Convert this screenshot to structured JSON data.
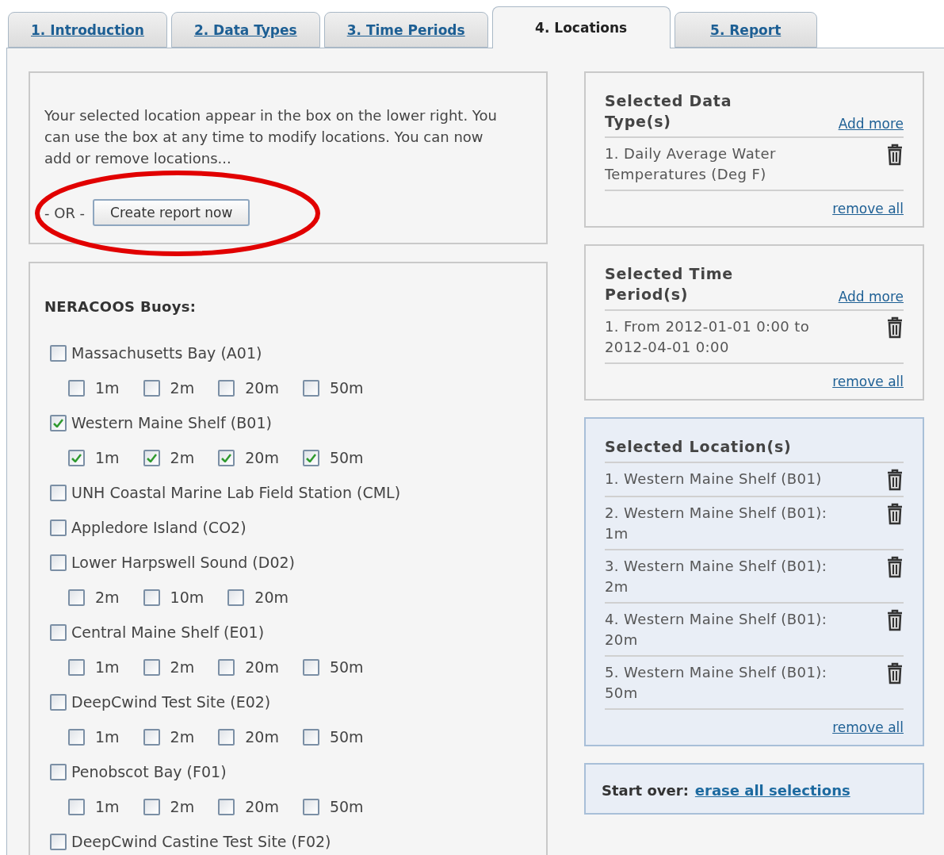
{
  "tabs": [
    {
      "label": "1. Introduction",
      "selected": false
    },
    {
      "label": "2. Data Types",
      "selected": false
    },
    {
      "label": "3. Time Periods",
      "selected": false
    },
    {
      "label": "4. Locations",
      "selected": true
    },
    {
      "label": "5. Report",
      "selected": false
    }
  ],
  "intro": {
    "text": "Your selected location appear in the box on the lower right. You can use the box at any time to modify locations. You can now add or remove locations...",
    "or_label": "- OR -",
    "button": "Create report now"
  },
  "buoys": {
    "title": "NERACOOS Buoys:",
    "stations": [
      {
        "name": "Massachusetts Bay (A01)",
        "checked": false,
        "depths": [
          {
            "label": "1m",
            "checked": false
          },
          {
            "label": "2m",
            "checked": false
          },
          {
            "label": "20m",
            "checked": false
          },
          {
            "label": "50m",
            "checked": false
          }
        ]
      },
      {
        "name": "Western Maine Shelf (B01)",
        "checked": true,
        "depths": [
          {
            "label": "1m",
            "checked": true
          },
          {
            "label": "2m",
            "checked": true
          },
          {
            "label": "20m",
            "checked": true
          },
          {
            "label": "50m",
            "checked": true
          }
        ]
      },
      {
        "name": "UNH Coastal Marine Lab Field Station (CML)",
        "checked": false
      },
      {
        "name": "Appledore Island (CO2)",
        "checked": false
      },
      {
        "name": "Lower Harpswell Sound (D02)",
        "checked": false,
        "depths": [
          {
            "label": "2m",
            "checked": false
          },
          {
            "label": "10m",
            "checked": false
          },
          {
            "label": "20m",
            "checked": false
          }
        ]
      },
      {
        "name": "Central Maine Shelf (E01)",
        "checked": false,
        "depths": [
          {
            "label": "1m",
            "checked": false
          },
          {
            "label": "2m",
            "checked": false
          },
          {
            "label": "20m",
            "checked": false
          },
          {
            "label": "50m",
            "checked": false
          }
        ]
      },
      {
        "name": "DeepCwind Test Site (E02)",
        "checked": false,
        "depths": [
          {
            "label": "1m",
            "checked": false
          },
          {
            "label": "2m",
            "checked": false
          },
          {
            "label": "20m",
            "checked": false
          },
          {
            "label": "50m",
            "checked": false
          }
        ]
      },
      {
        "name": "Penobscot Bay (F01)",
        "checked": false,
        "depths": [
          {
            "label": "1m",
            "checked": false
          },
          {
            "label": "2m",
            "checked": false
          },
          {
            "label": "20m",
            "checked": false
          },
          {
            "label": "50m",
            "checked": false
          }
        ]
      },
      {
        "name": "DeepCwind Castine Test Site (F02)",
        "checked": false
      }
    ]
  },
  "summary_boxes": [
    {
      "title": "Selected Data Type(s)",
      "add_more": "Add more",
      "highlighted": false,
      "items": [
        "1. Daily Average Water Temperatures (Deg F)"
      ],
      "remove_all": "remove all"
    },
    {
      "title": "Selected Time Period(s)",
      "add_more": "Add more",
      "highlighted": false,
      "items": [
        "1. From 2012-01-01 0:00 to 2012-04-01 0:00"
      ],
      "remove_all": "remove all"
    },
    {
      "title": "Selected Location(s)",
      "highlighted": true,
      "items": [
        "1. Western Maine Shelf (B01)",
        "2. Western Maine Shelf (B01): 1m",
        "3. Western Maine Shelf (B01): 2m",
        "4. Western Maine Shelf (B01): 20m",
        "5. Western Maine Shelf (B01): 50m"
      ],
      "remove_all": "remove all"
    }
  ],
  "start_over": {
    "label": "Start over:",
    "link": "erase all selections"
  }
}
